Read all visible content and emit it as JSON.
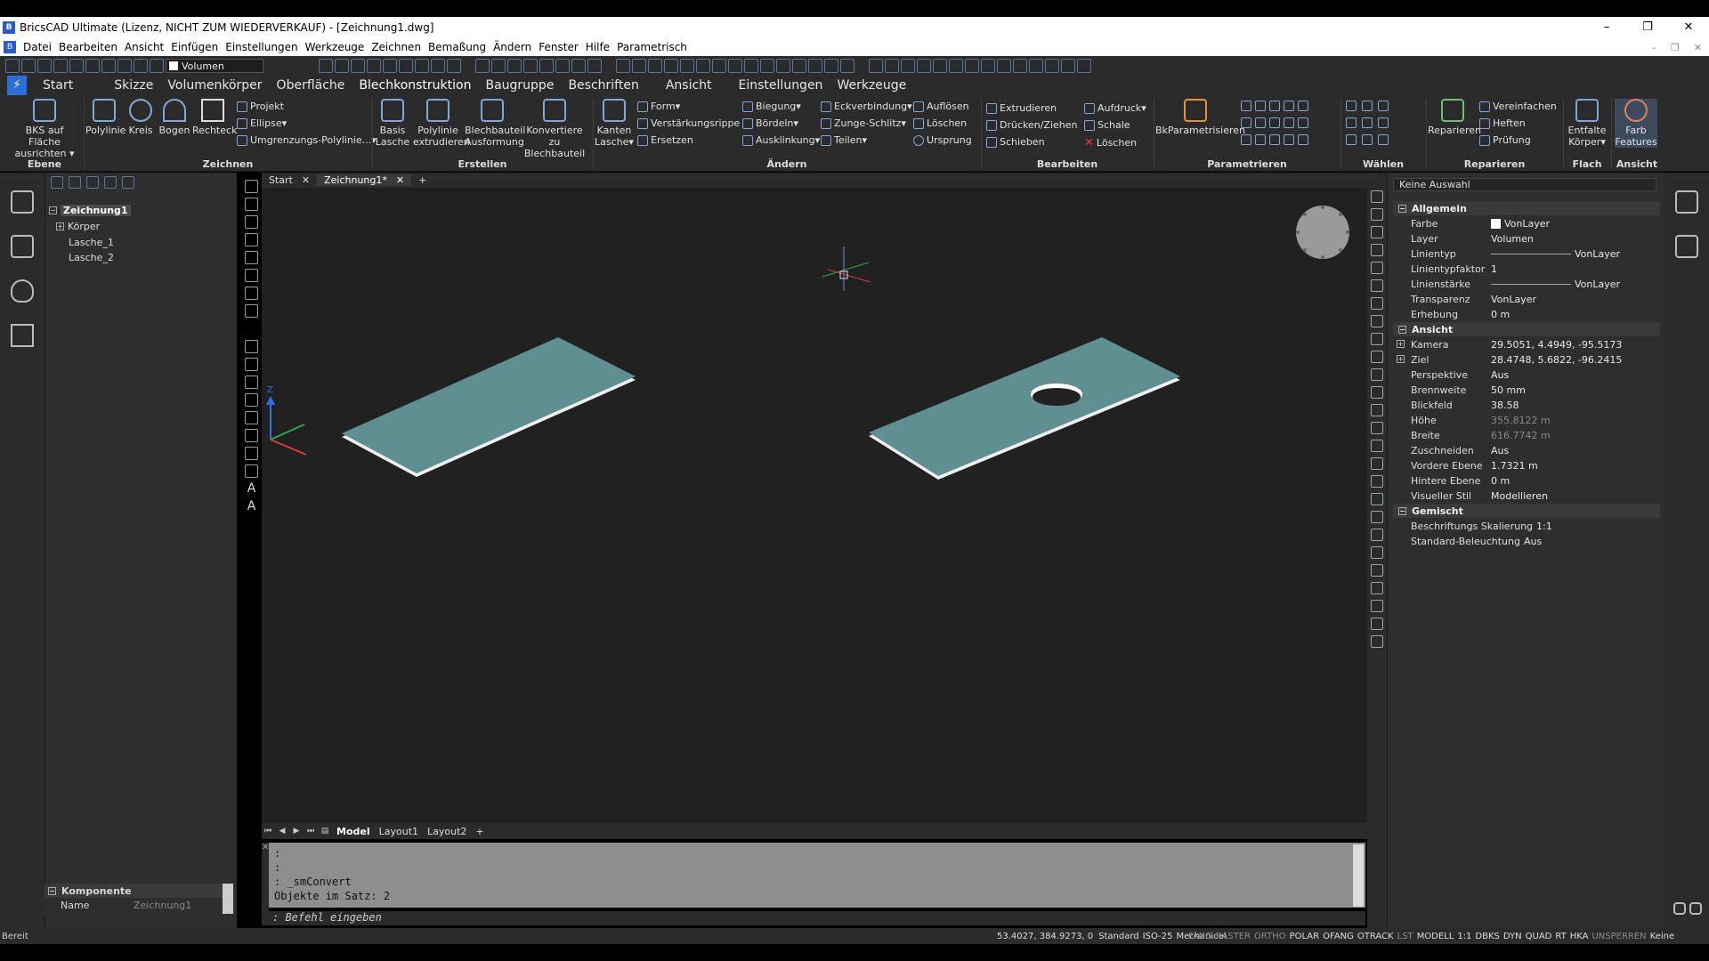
{
  "window": {
    "title": "BricsCAD Ultimate (Lizenz, NICHT ZUM WIEDERVERKAUF) - [Zeichnung1.dwg]",
    "minimize": "–",
    "maximize": "❐",
    "close": "✕"
  },
  "menu": [
    "Datei",
    "Bearbeiten",
    "Ansicht",
    "Einfügen",
    "Einstellungen",
    "Werkzeuge",
    "Zeichnen",
    "Bemaßung",
    "Ändern",
    "Fenster",
    "Hilfe",
    "Parametrisch"
  ],
  "qat": {
    "layer_name": "Volumen"
  },
  "ribbon_tabs": [
    "Start",
    "Skizze",
    "Volumenkörper",
    "Oberfläche",
    "Blechkonstruktion",
    "Baugruppe",
    "Beschriften",
    "Ansicht",
    "Einstellungen",
    "Werkzeuge"
  ],
  "ribbon": {
    "ebene": {
      "label": "Ebene",
      "bks": "BKS auf Fläche ausrichten ▾"
    },
    "zeichnen": {
      "label": "Zeichnen",
      "polylinie": "Polylinie",
      "kreis": "Kreis",
      "bogen": "Bogen",
      "rechteck": "Rechteck",
      "projekt": "Projekt",
      "ellipse": "Ellipse▾",
      "umgrenzung": "Umgrenzungs-Polylinie...▾"
    },
    "erstellen": {
      "label": "Erstellen",
      "basis": "Basis Lasche",
      "polylinie_extr": "Polylinie extrudieren",
      "blech_ausf": "Blechbauteil Ausformung",
      "konvertiere": "Konvertiere zu Blechbauteil"
    },
    "aendern": {
      "label": "Ändern",
      "kanten": "Kanten Lasche▾",
      "form": "Form▾",
      "verstaerkung": "Verstärkungsrippe",
      "ersetzen": "Ersetzen",
      "biegung": "Biegung▾",
      "boerdeln": "Bördeln▾",
      "ausklinkung": "Ausklinkung▾",
      "eckverbindung": "Eckverbindung▾",
      "zunge": "Zunge-Schlitz▾",
      "teilen": "Teilen▾",
      "aufloesen": "Auflösen",
      "loeschen": "Löschen",
      "ursprung": "Ursprung"
    },
    "bearbeiten": {
      "label": "Bearbeiten",
      "extrudieren": "Extrudieren",
      "druecken": "Drücken/Ziehen",
      "schieben": "Schieben",
      "aufdruck": "Aufdruck▾",
      "schale": "Schale",
      "loeschen": "Löschen"
    },
    "parametrieren": {
      "label": "Parametrieren",
      "bkp": "BkParametrisieren"
    },
    "waehlen": {
      "label": "Wählen"
    },
    "reparieren": {
      "label": "Reparieren",
      "reparieren_btn": "Reparieren",
      "vereinfachen": "Vereinfachen",
      "heften": "Heften",
      "pruefung": "Prüfung"
    },
    "flach": {
      "label": "Flach",
      "entfalte": "Entfalte Körper▾"
    },
    "ansicht": {
      "label": "Ansicht",
      "farb": "Farb Features"
    }
  },
  "explorer": {
    "root": "Zeichnung1",
    "items": [
      "Körper",
      "Lasche_1",
      "Lasche_2"
    ]
  },
  "komponente": {
    "title": "Komponente",
    "name_label": "Name",
    "name_value": "Zeichnung1"
  },
  "doc_tabs": [
    {
      "label": "Start",
      "close": "✕"
    },
    {
      "label": "Zeichnung1*",
      "close": "✕"
    }
  ],
  "doc_add": "+",
  "layout_tabs": [
    "Model",
    "Layout1",
    "Layout2"
  ],
  "layout_add": "+",
  "command": {
    "history": ":\n:\n: _smConvert\nObjekte im Satz: 2",
    "prompt": ": Befehl eingeben"
  },
  "status": {
    "ready": "Bereit",
    "coords": "53.4027, 384.9273, 0",
    "std1": "Standard",
    "std2": "ISO-25",
    "std3": "Mechanical",
    "toggles": [
      "FANG",
      "RASTER",
      "ORTHO",
      "POLAR",
      "OFANG",
      "OTRACK",
      "LST",
      "MODELL",
      "1:1",
      "DBKS",
      "DYN",
      "QUAD",
      "RT",
      "HKA",
      "UNSPERREN",
      "Keine"
    ],
    "toggles_off": [
      "FANG",
      "RASTER",
      "ORTHO",
      "LST",
      "UNSPERREN"
    ]
  },
  "properties": {
    "selection": "Keine Auswahl",
    "sections": {
      "allgemein": "Allgemein",
      "ansicht": "Ansicht",
      "gemischt": "Gemischt"
    },
    "allgemein": [
      {
        "k": "Farbe",
        "v": "VonLayer"
      },
      {
        "k": "Layer",
        "v": "Volumen"
      },
      {
        "k": "Linientyp",
        "v": "VonLayer"
      },
      {
        "k": "Linientypfaktor",
        "v": "1"
      },
      {
        "k": "Linienstärke",
        "v": "VonLayer"
      },
      {
        "k": "Transparenz",
        "v": "VonLayer"
      },
      {
        "k": "Erhebung",
        "v": "0 m"
      }
    ],
    "ansicht": [
      {
        "k": "Kamera",
        "v": "29.5051, 4.4949, -95.5173"
      },
      {
        "k": "Ziel",
        "v": "28.4748, 5.6822, -96.2415"
      },
      {
        "k": "Perspektive",
        "v": "Aus"
      },
      {
        "k": "Brennweite",
        "v": "50 mm"
      },
      {
        "k": "Blickfeld",
        "v": "38.58"
      },
      {
        "k": "Höhe",
        "v": "355.8122 m"
      },
      {
        "k": "Breite",
        "v": "616.7742 m"
      },
      {
        "k": "Zuschneiden",
        "v": "Aus"
      },
      {
        "k": "Vordere Ebene",
        "v": "1.7321 m"
      },
      {
        "k": "Hintere Ebene",
        "v": "0 m"
      },
      {
        "k": "Visueller Stil",
        "v": "Modellieren"
      }
    ],
    "gemischt": [
      {
        "k": "Beschriftungs Skalierung",
        "v": "1:1"
      },
      {
        "k": "Standard-Beleuchtung",
        "v": "Aus"
      }
    ]
  },
  "viewport": {
    "plate_color": "#5f8f91",
    "bg": "#212121",
    "axis_z": "Z"
  }
}
